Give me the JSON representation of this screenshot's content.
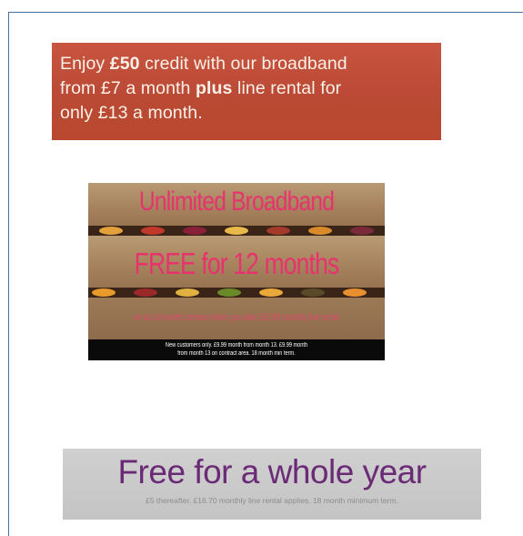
{
  "banner1": {
    "line1_pre": "Enjoy ",
    "line1_bold": "£50",
    "line1_post": " credit with our broadband",
    "line2_pre": "from £7 a month ",
    "line2_bold": "plus",
    "line2_post": " line rental for",
    "line3": "only £13 a month.",
    "colors": {
      "background": "#bb4a36",
      "text": "#fbf1e8"
    }
  },
  "banner2": {
    "headline": "Unlimited Broadband",
    "subheadline": "FREE for 12 months",
    "offer_note": "on an 18 month contract when you take £15.95 monthly line rental",
    "footer_line1": "New customers only. £9.99 month from month 13. £9.99 month",
    "footer_line2": "from month 13 on contract area. 18 month min term.",
    "colors": {
      "accent": "#e8326e",
      "footer_bg": "#0a0a0a"
    }
  },
  "banner3": {
    "headline": "Free for a whole year",
    "subtext": "£5 thereafter. £16.70 monthly line rental applies. 18 month minimum term.",
    "colors": {
      "headline": "#6b2a76",
      "background": "#c8c8c8"
    }
  }
}
